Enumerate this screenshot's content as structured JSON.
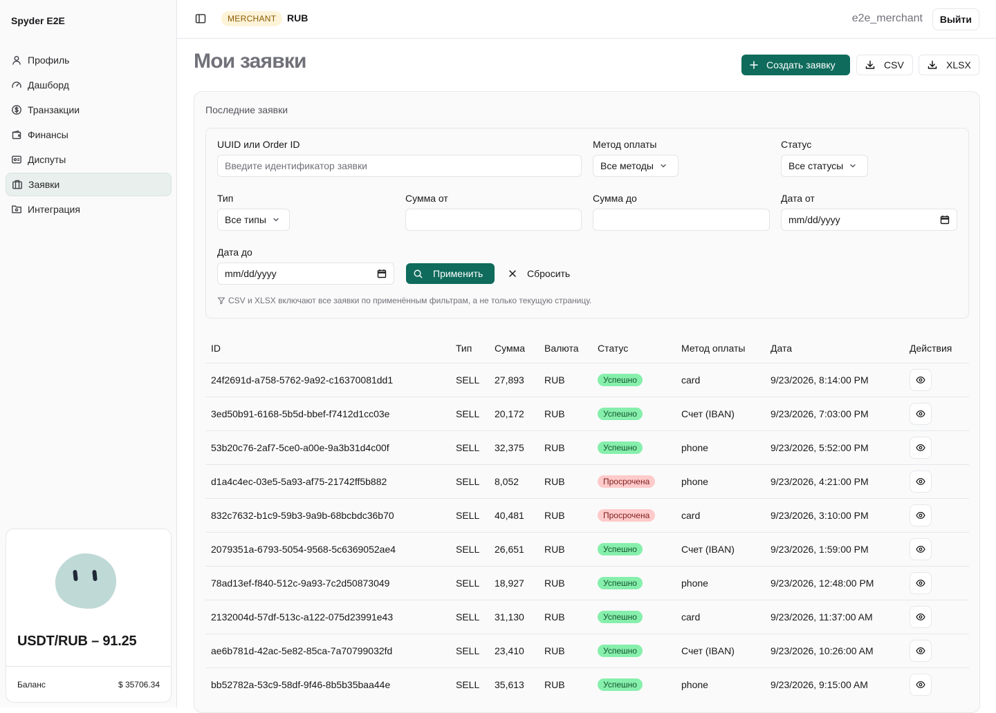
{
  "app": {
    "brand": "Spyder E2E"
  },
  "sidebar": {
    "items": [
      {
        "label": "Профиль",
        "icon": "user-icon"
      },
      {
        "label": "Дашборд",
        "icon": "gauge-icon"
      },
      {
        "label": "Транзакции",
        "icon": "dollar-circle-icon"
      },
      {
        "label": "Финансы",
        "icon": "wallet-icon"
      },
      {
        "label": "Диспуты",
        "icon": "dispute-icon"
      },
      {
        "label": "Заявки",
        "icon": "orders-icon",
        "active": true
      },
      {
        "label": "Интеграция",
        "icon": "integration-icon"
      }
    ],
    "widget": {
      "rate": "USDT/RUB – 91.25",
      "balance_label": "Баланс",
      "balance_value": "$ 35706.34"
    }
  },
  "header": {
    "role_badge": "MERCHANT",
    "currency": "RUB",
    "username": "e2e_merchant",
    "logout_label": "Выйти"
  },
  "page": {
    "title": "Мои заявки",
    "create_label": "Создать заявку",
    "csv_label": "CSV",
    "xlsx_label": "XLSX"
  },
  "card": {
    "title": "Последние заявки"
  },
  "filters": {
    "id_label": "UUID или Order ID",
    "id_placeholder": "Введите идентификатор заявки",
    "method_label": "Метод оплаты",
    "method_value": "Все методы",
    "status_label": "Статус",
    "status_value": "Все статусы",
    "type_label": "Тип",
    "type_value": "Все типы",
    "sum_from_label": "Сумма от",
    "sum_to_label": "Сумма до",
    "date_from_label": "Дата от",
    "date_from_value": "mm/dd/yyyy",
    "date_to_label": "Дата до",
    "date_to_value": "mm/dd/yyyy",
    "apply_label": "Применить",
    "reset_label": "Сбросить",
    "hint": "CSV и XLSX включают все заявки по применённым фильтрам, а не только текущую страницу."
  },
  "table": {
    "headers": {
      "id": "ID",
      "type": "Тип",
      "sum": "Сумма",
      "currency": "Валюта",
      "status": "Статус",
      "method": "Метод оплаты",
      "date": "Дата",
      "actions": "Действия"
    },
    "rows": [
      {
        "id": "24f2691d-a758-5762-9a92-c16370081dd1",
        "type": "SELL",
        "sum": "27,893",
        "currency": "RUB",
        "status": "Успешно",
        "status_kind": "ok",
        "method": "card",
        "date": "9/23/2026, 8:14:00 PM"
      },
      {
        "id": "3ed50b91-6168-5b5d-bbef-f7412d1cc03e",
        "type": "SELL",
        "sum": "20,172",
        "currency": "RUB",
        "status": "Успешно",
        "status_kind": "ok",
        "method": "Счет (IBAN)",
        "date": "9/23/2026, 7:03:00 PM"
      },
      {
        "id": "53b20c76-2af7-5ce0-a00e-9a3b31d4c00f",
        "type": "SELL",
        "sum": "32,375",
        "currency": "RUB",
        "status": "Успешно",
        "status_kind": "ok",
        "method": "phone",
        "date": "9/23/2026, 5:52:00 PM"
      },
      {
        "id": "d1a4c4ec-03e5-5a93-af75-21742ff5b882",
        "type": "SELL",
        "sum": "8,052",
        "currency": "RUB",
        "status": "Просрочена",
        "status_kind": "late",
        "method": "phone",
        "date": "9/23/2026, 4:21:00 PM"
      },
      {
        "id": "832c7632-b1c9-59b3-9a9b-68bcbdc36b70",
        "type": "SELL",
        "sum": "40,481",
        "currency": "RUB",
        "status": "Просрочена",
        "status_kind": "late",
        "method": "card",
        "date": "9/23/2026, 3:10:00 PM"
      },
      {
        "id": "2079351a-6793-5054-9568-5c6369052ae4",
        "type": "SELL",
        "sum": "26,651",
        "currency": "RUB",
        "status": "Успешно",
        "status_kind": "ok",
        "method": "Счет (IBAN)",
        "date": "9/23/2026, 1:59:00 PM"
      },
      {
        "id": "78ad13ef-f840-512c-9a93-7c2d50873049",
        "type": "SELL",
        "sum": "18,927",
        "currency": "RUB",
        "status": "Успешно",
        "status_kind": "ok",
        "method": "phone",
        "date": "9/23/2026, 12:48:00 PM"
      },
      {
        "id": "2132004d-57df-513c-a122-075d23991e43",
        "type": "SELL",
        "sum": "31,130",
        "currency": "RUB",
        "status": "Успешно",
        "status_kind": "ok",
        "method": "card",
        "date": "9/23/2026, 11:37:00 AM"
      },
      {
        "id": "ae6b781d-42ac-5e82-85ca-7a70799032fd",
        "type": "SELL",
        "sum": "23,410",
        "currency": "RUB",
        "status": "Успешно",
        "status_kind": "ok",
        "method": "Счет (IBAN)",
        "date": "9/23/2026, 10:26:00 AM"
      },
      {
        "id": "bb52782a-53c9-58df-9f46-8b5b35baa44e",
        "type": "SELL",
        "sum": "35,613",
        "currency": "RUB",
        "status": "Успешно",
        "status_kind": "ok",
        "method": "phone",
        "date": "9/23/2026, 9:15:00 AM"
      }
    ]
  },
  "colors": {
    "accent": "#0f6b5c",
    "badge_ok": "#86efac",
    "badge_late": "#fecaca",
    "role_badge_bg": "#fdf3d8"
  }
}
